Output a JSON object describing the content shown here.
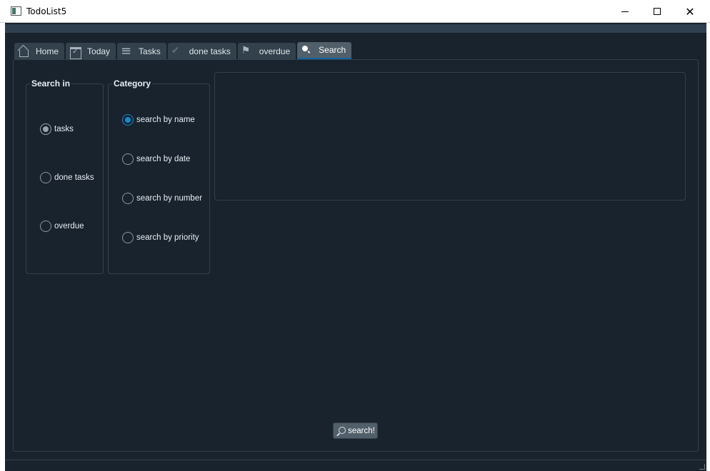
{
  "window": {
    "title": "TodoList5",
    "minimize": "minimize",
    "maximize": "maximize",
    "close_glyph": "✕"
  },
  "tabs": [
    {
      "label": "Home",
      "icon": "home-icon"
    },
    {
      "label": "Today",
      "icon": "calendar-check-icon"
    },
    {
      "label": "Tasks",
      "icon": "list-icon"
    },
    {
      "label": "done tasks",
      "icon": "checkmark-icon"
    },
    {
      "label": "overdue",
      "icon": "flag-icon"
    },
    {
      "label": "Search",
      "icon": "search-icon",
      "active": true
    }
  ],
  "search_in": {
    "title": "Search in",
    "options": [
      {
        "label": "tasks",
        "checked": true
      },
      {
        "label": "done tasks",
        "checked": false
      },
      {
        "label": "overdue",
        "checked": false
      }
    ]
  },
  "category": {
    "title": "Category",
    "options": [
      {
        "label": "search by name",
        "checked": true
      },
      {
        "label": "search by date",
        "checked": false
      },
      {
        "label": "search by number",
        "checked": false
      },
      {
        "label": "search by priority",
        "checked": false
      }
    ]
  },
  "search_button": {
    "label": "search!"
  },
  "colors": {
    "background": "#19232d",
    "accent": "#148cd2",
    "tab_active": "#505f69",
    "tab_inactive": "#32414b"
  }
}
